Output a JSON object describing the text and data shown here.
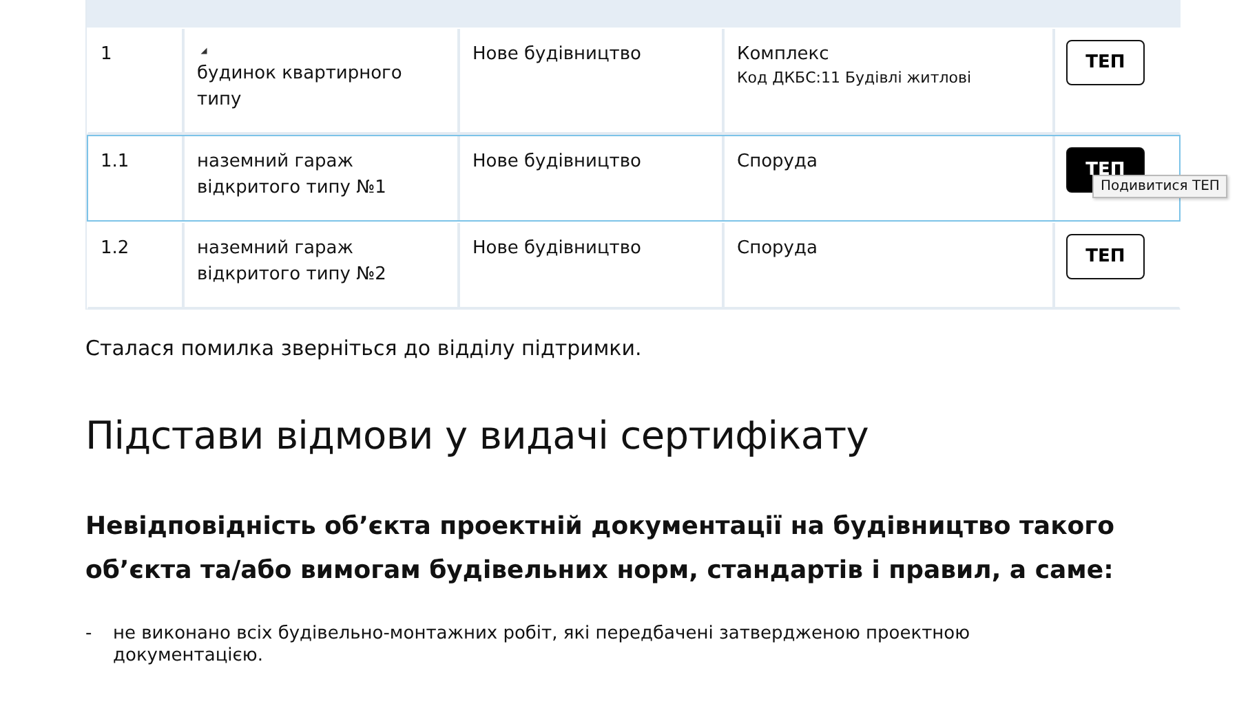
{
  "table": {
    "rows": [
      {
        "number": "1",
        "name": "будинок квартирного типу",
        "type": "Нове будівництво",
        "category": "Комплекс",
        "code": "Код ДКБС:11 Будівлі житлові",
        "button": "ТЕП",
        "hovered": false,
        "expanded": true,
        "children": [
          {
            "number": "1.1",
            "name": "наземний гараж відкритого типу №1",
            "type": "Нове будівництво",
            "category": "Споруда",
            "button": "ТЕП",
            "hovered": true,
            "tooltip": "Подивитися ТЕП"
          },
          {
            "number": "1.2",
            "name": "наземний гараж відкритого типу №2",
            "type": "Нове будівництво",
            "category": "Споруда",
            "button": "ТЕП",
            "hovered": false
          }
        ]
      }
    ]
  },
  "error_message": "Сталася помилка зверніться до відділу підтримки.",
  "section_title": "Підстави відмови у видачі сертифікату",
  "reason_heading": "Невідповідність об’єкта проектній документації на будівництво такого об’єкта та/або вимогам будівельних норм, стандартів і правил, а саме:",
  "reasons": [
    {
      "marker": "-",
      "text": "не виконано всіх будівельно-монтажних робіт, які передбачені затвердженою проектною документацією."
    }
  ]
}
